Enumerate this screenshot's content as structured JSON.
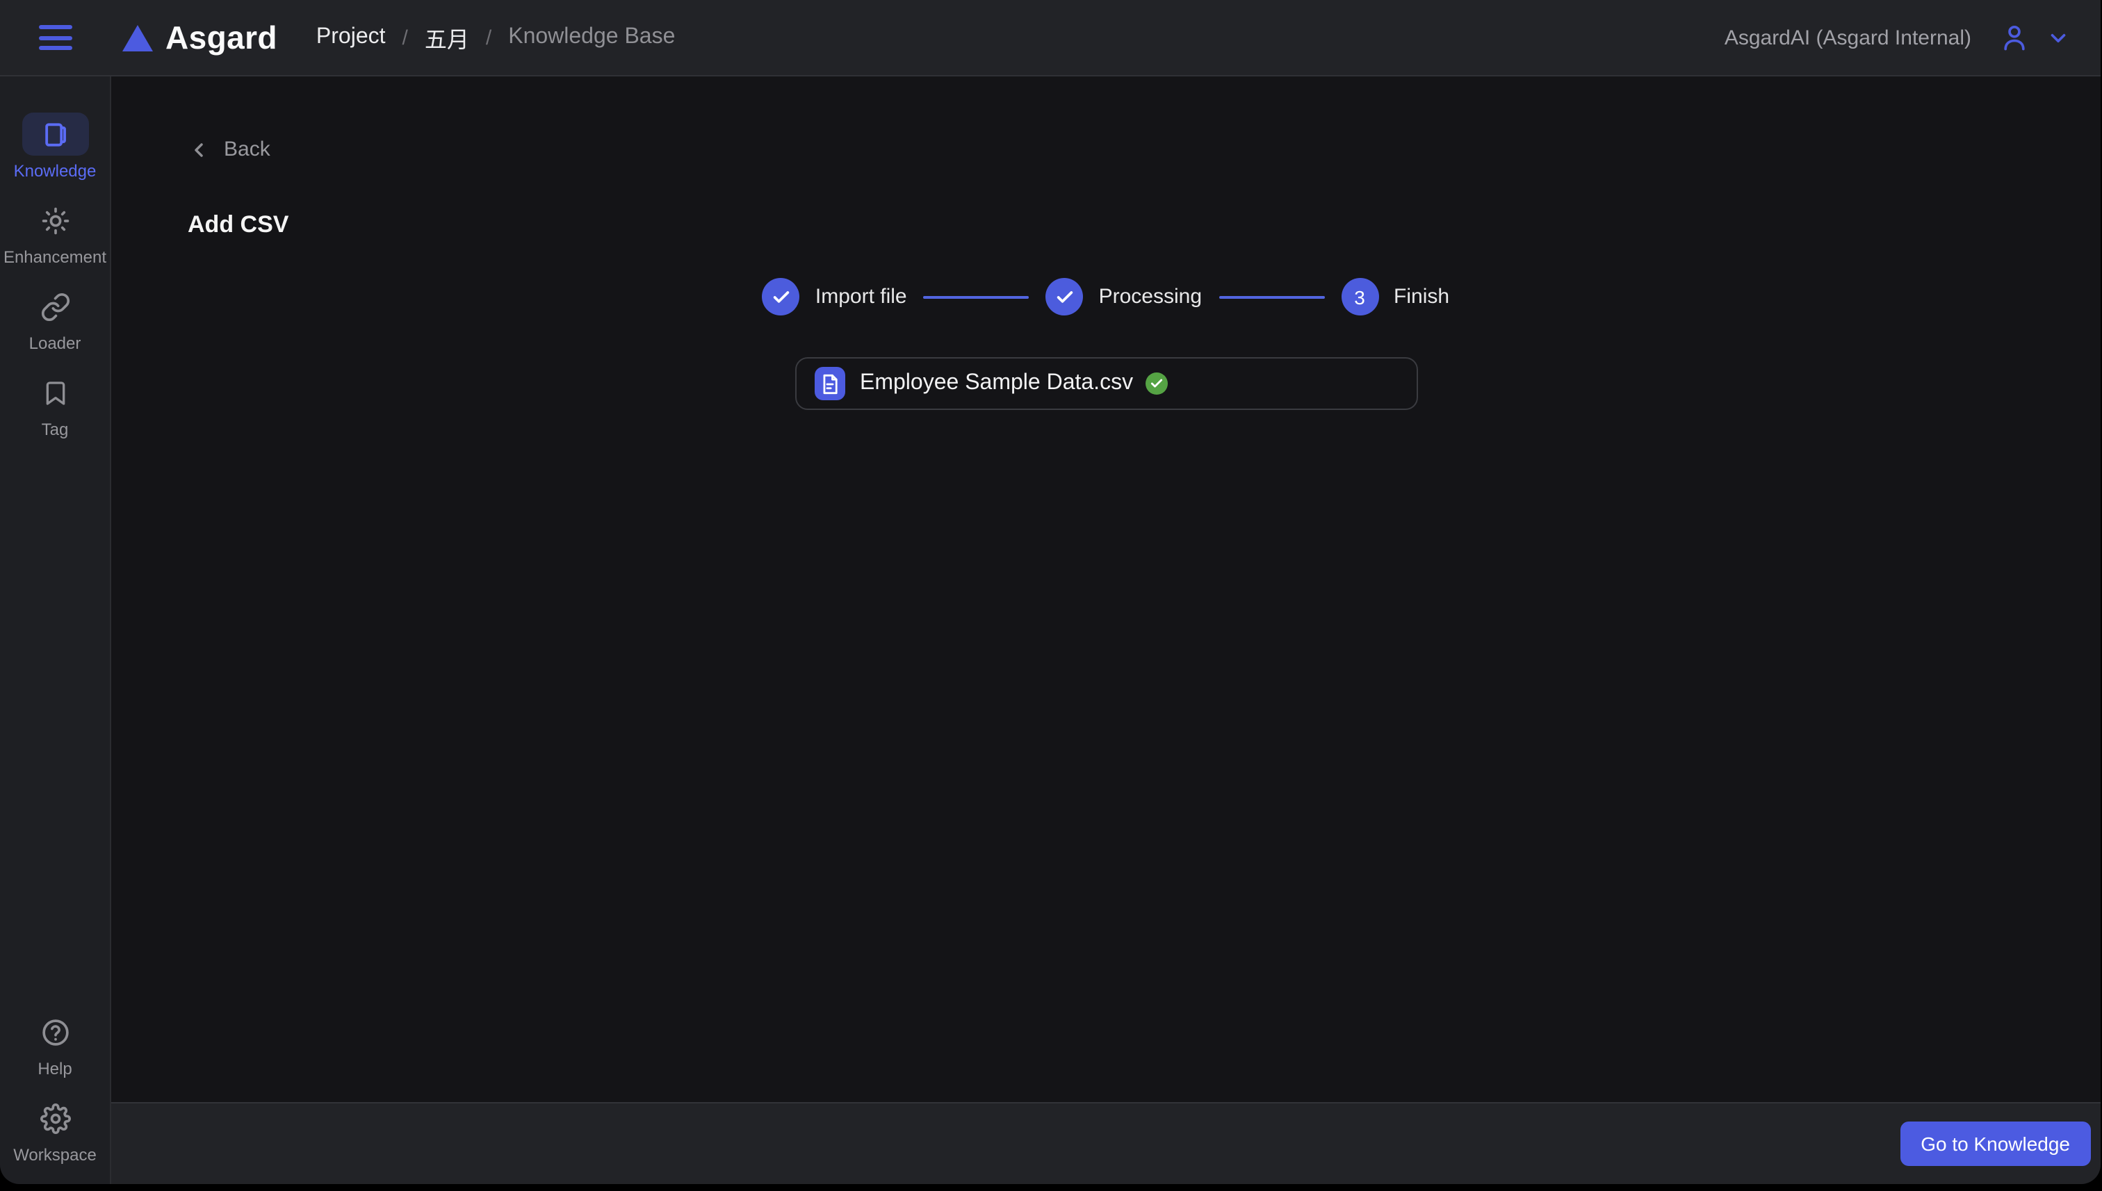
{
  "header": {
    "logo_text": "Asgard",
    "breadcrumb": {
      "separator": "/",
      "items": [
        "Project",
        "五月",
        "Knowledge Base"
      ]
    },
    "account_label": "AsgardAI (Asgard Internal)"
  },
  "sidebar": {
    "active_item": "Knowledge",
    "items": [
      {
        "label": "Knowledge",
        "icon": "book-icon"
      },
      {
        "label": "Enhancement",
        "icon": "sun-icon"
      },
      {
        "label": "Loader",
        "icon": "link-icon"
      },
      {
        "label": "Tag",
        "icon": "bookmark-icon"
      }
    ],
    "bottom_items": [
      {
        "label": "Help",
        "icon": "help-circle-icon"
      },
      {
        "label": "Workspace",
        "icon": "gear-icon"
      }
    ]
  },
  "main": {
    "back_label": "Back",
    "page_title": "Add CSV",
    "stepper": {
      "steps": [
        {
          "label": "Import file",
          "state": "done"
        },
        {
          "label": "Processing",
          "state": "done"
        },
        {
          "label": "Finish",
          "state": "current",
          "number": "3"
        }
      ]
    },
    "file_card": {
      "file_name": "Employee Sample Data.csv",
      "status": "success"
    }
  },
  "footer": {
    "go_to_knowledge_label": "Go to Knowledge"
  },
  "colors": {
    "accent_blue": "#4c5be0",
    "link_blue": "#5b6cf5",
    "success_green": "#55a344"
  }
}
